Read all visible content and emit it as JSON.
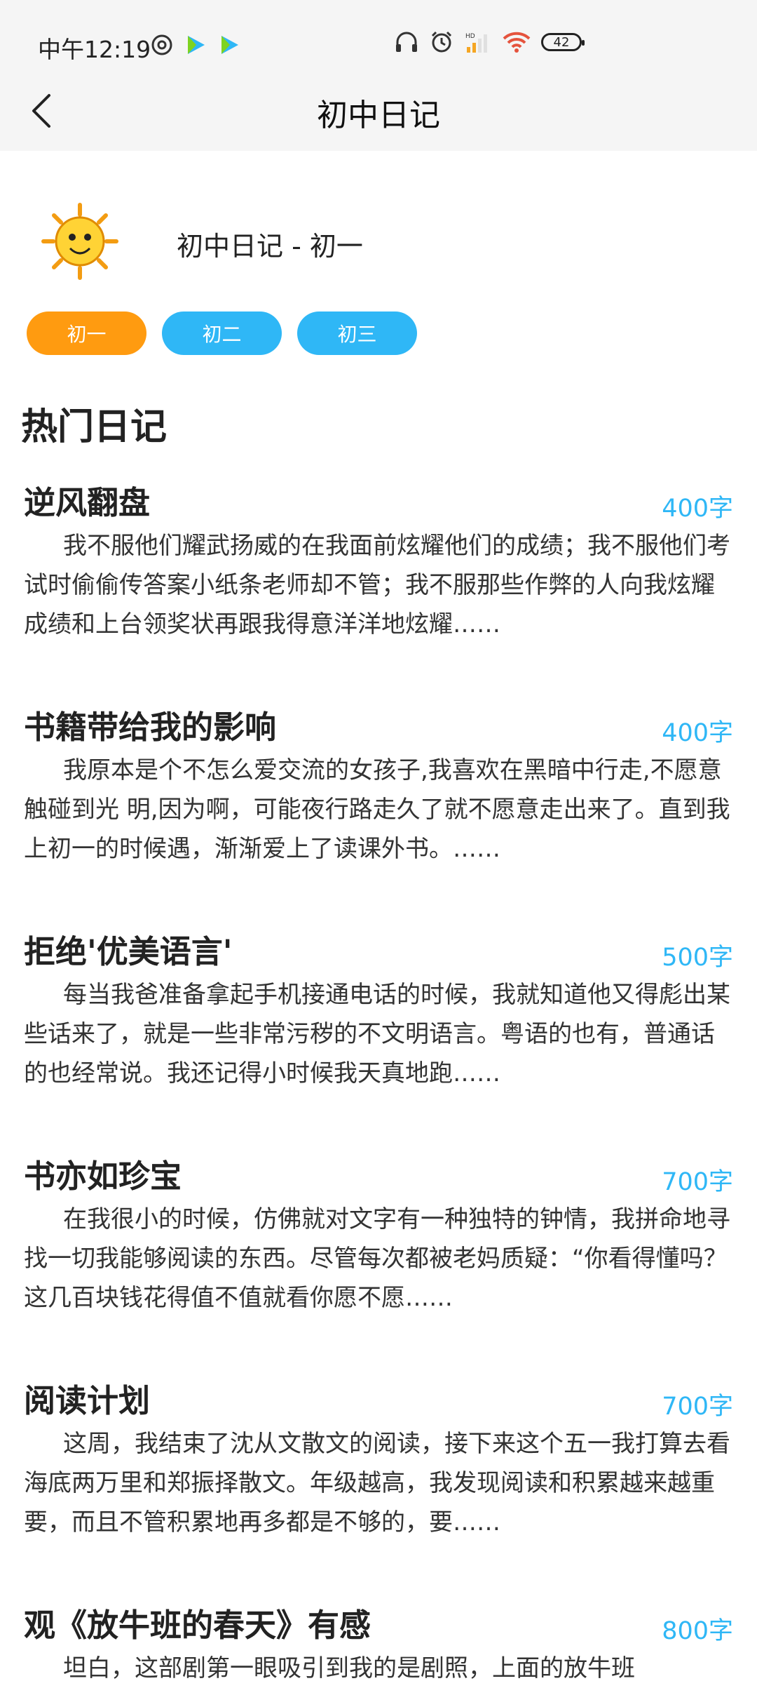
{
  "status": {
    "time": "中午12:19",
    "battery": "42"
  },
  "nav": {
    "title": "初中日记"
  },
  "header": {
    "label": "初中日记 - 初一"
  },
  "tabs": [
    "初一",
    "初二",
    "初三"
  ],
  "section": {
    "title": "热门日记"
  },
  "diaries": [
    {
      "title": "逆风翻盘",
      "word_count": "400字",
      "excerpt": "我不服他们耀武扬威的在我面前炫耀他们的成绩；我不服他们考试时偷偷传答案小纸条老师却不管；我不服那些作弊的人向我炫耀成绩和上台领奖状再跟我得意洋洋地炫耀……"
    },
    {
      "title": "书籍带给我的影响",
      "word_count": "400字",
      "excerpt": "我原本是个不怎么爱交流的女孩子,我喜欢在黑暗中行走,不愿意触碰到光 明,因为啊，可能夜行路走久了就不愿意走出来了。直到我上初一的时候遇，渐渐爱上了读课外书。……"
    },
    {
      "title": "拒绝'优美语言'",
      "word_count": "500字",
      "excerpt": "每当我爸准备拿起手机接通电话的时候，我就知道他又得彪出某些话来了，就是一些非常污秽的不文明语言。粤语的也有，普通话的也经常说。我还记得小时候我天真地跑……"
    },
    {
      "title": "书亦如珍宝",
      "word_count": "700字",
      "excerpt": "在我很小的时候，仿佛就对文字有一种独特的钟情，我拼命地寻找一切我能够阅读的东西。尽管每次都被老妈质疑：“你看得懂吗？这几百块钱花得值不值就看你愿不愿……"
    },
    {
      "title": "阅读计划",
      "word_count": "700字",
      "excerpt": "这周，我结束了沈从文散文的阅读，接下来这个五一我打算去看海底两万里和郑振择散文。年级越高，我发现阅读和积累越来越重要，而且不管积累地再多都是不够的，要……"
    },
    {
      "title": "观《放牛班的春天》有感",
      "word_count": "800字",
      "excerpt": "坦白，这部剧第一眼吸引到我的是剧照，上面的放牛班"
    }
  ],
  "colors": {
    "accent_orange": "#ff9b10",
    "accent_blue": "#2fb7f6"
  }
}
